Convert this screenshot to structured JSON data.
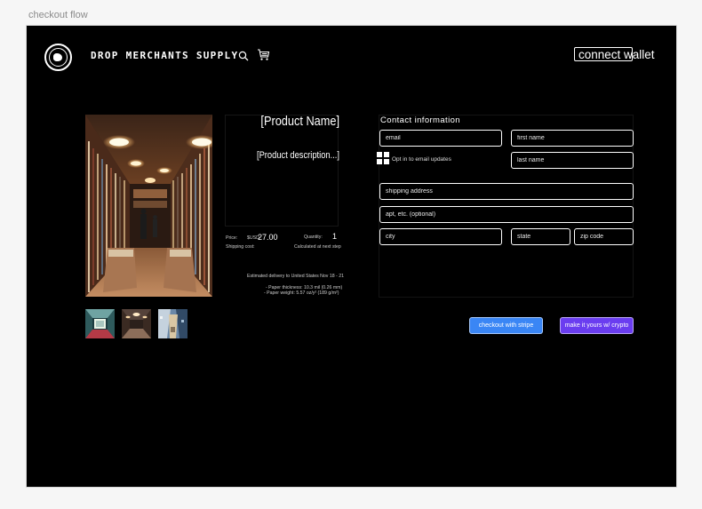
{
  "frame": {
    "label": "checkout flow"
  },
  "header": {
    "brand": "DROP MERCHANTS SUPPLY",
    "connect_wallet_label": "connect wallet"
  },
  "icons": {
    "logo": "globe-logo-icon",
    "search": "search-icon",
    "cart": "cart-icon",
    "optin": "grid-checkbox-icon"
  },
  "product": {
    "name": "[Product Name]",
    "description": "[Product description...]",
    "price_label": "Price:",
    "currency": "$USD",
    "price_value": "27.00",
    "quantity_label": "Quantity:",
    "quantity_value": "1",
    "shipping_label": "Shipping cost:",
    "shipping_value": "Calculated at next step",
    "delivery_estimate": "Estimated delivery to United States Nov 18 - 21",
    "paper_thickness": "- Paper thickness: 10.3 mil (0.26 mm)",
    "paper_weight": "- Paper weight: 5.57 oz/y² (189 g/m²)"
  },
  "thumbnails": [
    "thumbnail-1",
    "thumbnail-2",
    "thumbnail-3"
  ],
  "contact": {
    "title": "Contact information",
    "email_placeholder": "email",
    "first_name_placeholder": "first name",
    "last_name_placeholder": "last name",
    "optin_label": "Opt in to email updates",
    "shipping_address_placeholder": "shipping address",
    "apt_placeholder": "apt, etc. (optional)",
    "city_placeholder": "city",
    "state_placeholder": "state",
    "zip_placeholder": "zip code"
  },
  "actions": {
    "stripe_label": "checkout with stripe",
    "crypto_label": "make it yours w/ crypto"
  },
  "colors": {
    "background": "#000000",
    "stripe_button": "#3a86f5",
    "crypto_button": "#6a3df0"
  }
}
